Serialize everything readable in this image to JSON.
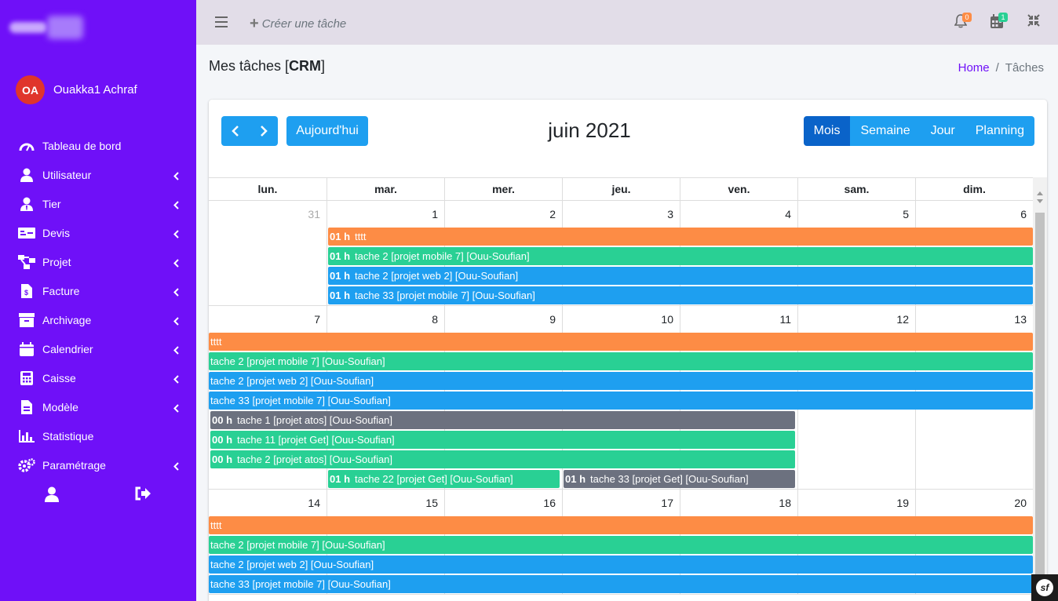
{
  "sidebar": {
    "user_initials": "OA",
    "user_name": "Ouakka1 Achraf",
    "items": [
      {
        "label": "Tableau de bord",
        "icon": "dashboard-icon",
        "has_children": false
      },
      {
        "label": "Utilisateur",
        "icon": "user-icon",
        "has_children": true
      },
      {
        "label": "Tier",
        "icon": "user-tie-icon",
        "has_children": true
      },
      {
        "label": "Devis",
        "icon": "money-bill-icon",
        "has_children": true
      },
      {
        "label": "Projet",
        "icon": "project-diagram-icon",
        "has_children": true
      },
      {
        "label": "Facture",
        "icon": "invoice-icon",
        "has_children": true
      },
      {
        "label": "Archivage",
        "icon": "archive-icon",
        "has_children": true
      },
      {
        "label": "Calendrier",
        "icon": "calendar-icon",
        "has_children": true
      },
      {
        "label": "Caisse",
        "icon": "calculator-icon",
        "has_children": true
      },
      {
        "label": "Modèle",
        "icon": "file-template-icon",
        "has_children": true
      },
      {
        "label": "Statistique",
        "icon": "chart-bar-icon",
        "has_children": false
      },
      {
        "label": "Paramétrage",
        "icon": "cogs-icon",
        "has_children": true
      }
    ]
  },
  "topbar": {
    "create_label": "Créer une tâche",
    "notif_count": "0",
    "calendar_count": "1"
  },
  "page": {
    "title_prefix": "Mes tâches [",
    "title_bold": "CRM",
    "title_suffix": "]",
    "breadcrumb_home": "Home",
    "breadcrumb_sep": "/",
    "breadcrumb_current": "Tâches"
  },
  "calendar": {
    "today_label": "Aujourd'hui",
    "title": "juin 2021",
    "views": [
      "Mois",
      "Semaine",
      "Jour",
      "Planning"
    ],
    "active_view": "Mois",
    "weekdays": [
      "lun.",
      "mar.",
      "mer.",
      "jeu.",
      "ven.",
      "sam.",
      "dim."
    ],
    "weeks": [
      {
        "days": [
          "31",
          "1",
          "2",
          "3",
          "4",
          "5",
          "6"
        ],
        "events": [
          {
            "time": "01 h",
            "title": "tttt",
            "color": "orange"
          },
          {
            "time": "01 h",
            "title": "tache 2 [projet mobile 7] [Ouu-Soufian]",
            "color": "green"
          },
          {
            "time": "01 h",
            "title": "tache 2 [projet web 2] [Ouu-Soufian]",
            "color": "blue"
          },
          {
            "time": "01 h",
            "title": "tache 33 [projet mobile 7] [Ouu-Soufian]",
            "color": "blue"
          }
        ]
      },
      {
        "days": [
          "7",
          "8",
          "9",
          "10",
          "11",
          "12",
          "13"
        ],
        "events": [
          {
            "time": "",
            "title": "tttt",
            "color": "orange"
          },
          {
            "time": "",
            "title": "tache 2 [projet mobile 7] [Ouu-Soufian]",
            "color": "green"
          },
          {
            "time": "",
            "title": "tache 2 [projet web 2] [Ouu-Soufian]",
            "color": "blue"
          },
          {
            "time": "",
            "title": "tache 33 [projet mobile 7] [Ouu-Soufian]",
            "color": "blue"
          },
          {
            "time": "00 h",
            "title": "tache 1 [projet atos] [Ouu-Soufian]",
            "color": "gray"
          },
          {
            "time": "00 h",
            "title": "tache 11 [projet Get] [Ouu-Soufian]",
            "color": "green"
          },
          {
            "time": "00 h",
            "title": "tache 2 [projet atos] [Ouu-Soufian]",
            "color": "green"
          },
          {
            "time": "01 h",
            "title": "tache 22 [projet Get] [Ouu-Soufian]",
            "color": "green"
          },
          {
            "time": "01 h",
            "title": "tache 33 [projet Get] [Ouu-Soufian]",
            "color": "gray"
          }
        ]
      },
      {
        "days": [
          "14",
          "15",
          "16",
          "17",
          "18",
          "19",
          "20"
        ],
        "events": [
          {
            "time": "",
            "title": "tttt",
            "color": "orange"
          },
          {
            "time": "",
            "title": "tache 2 [projet mobile 7] [Ouu-Soufian]",
            "color": "green"
          },
          {
            "time": "",
            "title": "tache 2 [projet web 2] [Ouu-Soufian]",
            "color": "blue"
          },
          {
            "time": "",
            "title": "tache 33 [projet mobile 7] [Ouu-Soufian]",
            "color": "blue"
          }
        ]
      }
    ]
  }
}
